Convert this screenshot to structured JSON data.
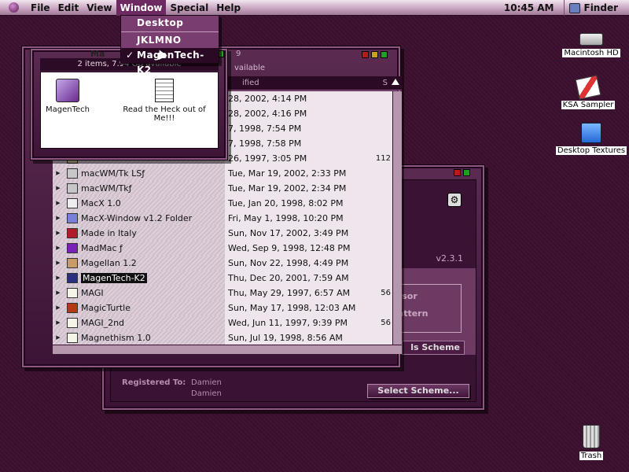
{
  "menubar": {
    "items": [
      "File",
      "Edit",
      "View",
      "Window",
      "Special",
      "Help"
    ],
    "clock": "10:45 AM",
    "app": "Finder"
  },
  "window_menu": {
    "items": [
      {
        "label": "Desktop",
        "checked": false,
        "selected": false
      },
      {
        "label": "JKLMNO",
        "checked": false,
        "selected": false
      },
      {
        "label": "MagenTech-K2",
        "checked": true,
        "selected": true
      }
    ]
  },
  "icon_window": {
    "title": "Ma",
    "status": "2 items, 7.94 GB available",
    "items": [
      {
        "label": "MagenTech"
      },
      {
        "label": "Read the Heck out of Me!!!"
      }
    ]
  },
  "list_window": {
    "title_partial": "9",
    "info_partial": "vailable",
    "header": {
      "modified": "ified",
      "size": "S"
    },
    "rows": [
      {
        "name": "",
        "date": "28, 2002, 4:14 PM",
        "size": "",
        "icon": "folder"
      },
      {
        "name": "",
        "date": "28, 2002, 4:16 PM",
        "size": "",
        "icon": "folder"
      },
      {
        "name": "",
        "date": "7, 1998, 7:54 PM",
        "size": "",
        "icon": "folder"
      },
      {
        "name": "",
        "date": "7, 1998, 7:58 PM",
        "size": "",
        "icon": "folder"
      },
      {
        "name": "",
        "date": "26, 1997, 3:05 PM",
        "size": "112",
        "icon": "folder"
      },
      {
        "name": "macWM/Tk LSƒ",
        "date": "Tue, Mar 19, 2002, 2:33 PM",
        "size": "",
        "icon": "folder2"
      },
      {
        "name": "macWM/Tkƒ",
        "date": "Tue, Mar 19, 2002, 2:34 PM",
        "size": "",
        "icon": "folder2"
      },
      {
        "name": "MacX 1.0",
        "date": "Tue, Jan 20, 1998, 8:02 PM",
        "size": "",
        "icon": "x"
      },
      {
        "name": "MacX-Window v1.2 Folder",
        "date": "Fri, May 1, 1998, 10:20 PM",
        "size": "",
        "icon": "blue"
      },
      {
        "name": "Made in Italy",
        "date": "Sun, Nov 17, 2002, 3:49 PM",
        "size": "",
        "icon": "red"
      },
      {
        "name": "MadMac ƒ",
        "date": "Wed, Sep 9, 1998, 12:48 PM",
        "size": "",
        "icon": "purple"
      },
      {
        "name": "Magellan 1.2",
        "date": "Sun, Nov 22, 1998, 4:49 PM",
        "size": "",
        "icon": "tan"
      },
      {
        "name": "MagenTech-K2",
        "date": "Thu, Dec 20, 2001, 7:59 AM",
        "size": "",
        "icon": "navy",
        "highlight": true
      },
      {
        "name": "MAGI",
        "date": "Thu, May 29, 1997, 6:57 AM",
        "size": "56",
        "icon": "doc"
      },
      {
        "name": "MagicTurtle",
        "date": "Sun, May 17, 1998, 12:03 AM",
        "size": "",
        "icon": "turtle"
      },
      {
        "name": "MAGI_2nd",
        "date": "Wed, Jun 11, 1997, 9:39 PM",
        "size": "56",
        "icon": "doc"
      },
      {
        "name": "Magnethism 1.0",
        "date": "Sun, Jul 19, 1998, 8:56 AM",
        "size": "",
        "icon": "doc"
      }
    ]
  },
  "magentech_window": {
    "version": "v2.3.1",
    "group_line1": "ursor",
    "group_line2": "Pattern",
    "scheme_button_partial": "ls Scheme",
    "registered_label": "Registered To:",
    "registered_name1": "Damien",
    "registered_name2": "Damien",
    "select_scheme_button": "Select Scheme..."
  },
  "desktop_icons": [
    {
      "label": "Macintosh HD",
      "icon": "hard-drive-icon"
    },
    {
      "label": "KSA Sampler",
      "icon": "ksa-sampler-icon"
    },
    {
      "label": "Desktop Textures",
      "icon": "folder-icon"
    },
    {
      "label": "Trash",
      "icon": "trash-icon"
    }
  ],
  "colors": {
    "desktop": "#3a0f2e",
    "accent": "#6d2a62",
    "highlight": "#111111"
  }
}
